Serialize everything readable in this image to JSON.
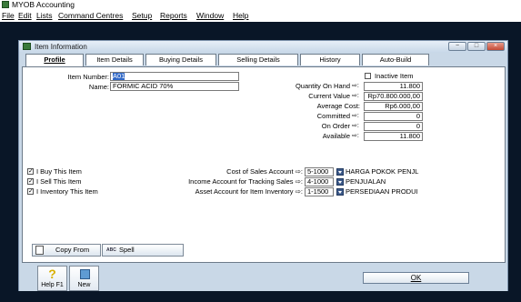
{
  "app": {
    "title": "MYOB Accounting"
  },
  "menu": [
    "File",
    "Edit",
    "Lists",
    "Command Centres",
    "Setup",
    "Reports",
    "Window",
    "Help"
  ],
  "window": {
    "title": "Item Information",
    "controls": {
      "minimize": "−",
      "maximize": "□",
      "close": "×"
    }
  },
  "tabs": [
    "Profile",
    "Item Details",
    "Buying Details",
    "Selling Details",
    "History",
    "Auto-Build"
  ],
  "item": {
    "number_label": "Item Number:",
    "number_value": "A01",
    "name_label": "Name:",
    "name_value": "FORMIC ACID 70%",
    "inactive_label": "Inactive Item"
  },
  "stats": [
    {
      "label": "Quantity On Hand",
      "value": "11.800"
    },
    {
      "label": "Current Value",
      "value": "Rp70.800.000,00"
    },
    {
      "label": "Average Cost:",
      "value": "Rp6.000,00"
    },
    {
      "label": "Committed",
      "value": "0"
    },
    {
      "label": "On Order",
      "value": "0"
    },
    {
      "label": "Available",
      "value": "11.800"
    }
  ],
  "stat_arrows": {
    "qty": "⇨:",
    "val": "⇨:",
    "com": "⇨:",
    "ord": "⇨:",
    "ava": "⇨:"
  },
  "flags": [
    {
      "label": "I Buy This Item",
      "checked": true,
      "mark": "✓"
    },
    {
      "label": "I Sell This Item",
      "checked": true,
      "mark": "✓"
    },
    {
      "label": "I Inventory This Item",
      "checked": true,
      "mark": "✓"
    }
  ],
  "accounts": [
    {
      "label": "Cost of Sales Account ⇨:",
      "number": "5-1000",
      "name": "HARGA POKOK PENJL"
    },
    {
      "label": "Income Account for Tracking Sales ⇨:",
      "number": "4-1000",
      "name": "PENJUALAN"
    },
    {
      "label": "Asset Account for Item Inventory ⇨:",
      "number": "1-1500",
      "name": "PERSEDIAAN PRODUI"
    }
  ],
  "panel_buttons": {
    "copy_from": "Copy From",
    "spell": "Spell",
    "spell_icon_text": "ABC"
  },
  "bottom": {
    "help": "Help F1",
    "help_icon": "?",
    "new": "New",
    "ok": "OK"
  },
  "colors": {
    "workspace": "#091627",
    "window_bg": "#c9d8e7",
    "selection": "#3168c6"
  }
}
